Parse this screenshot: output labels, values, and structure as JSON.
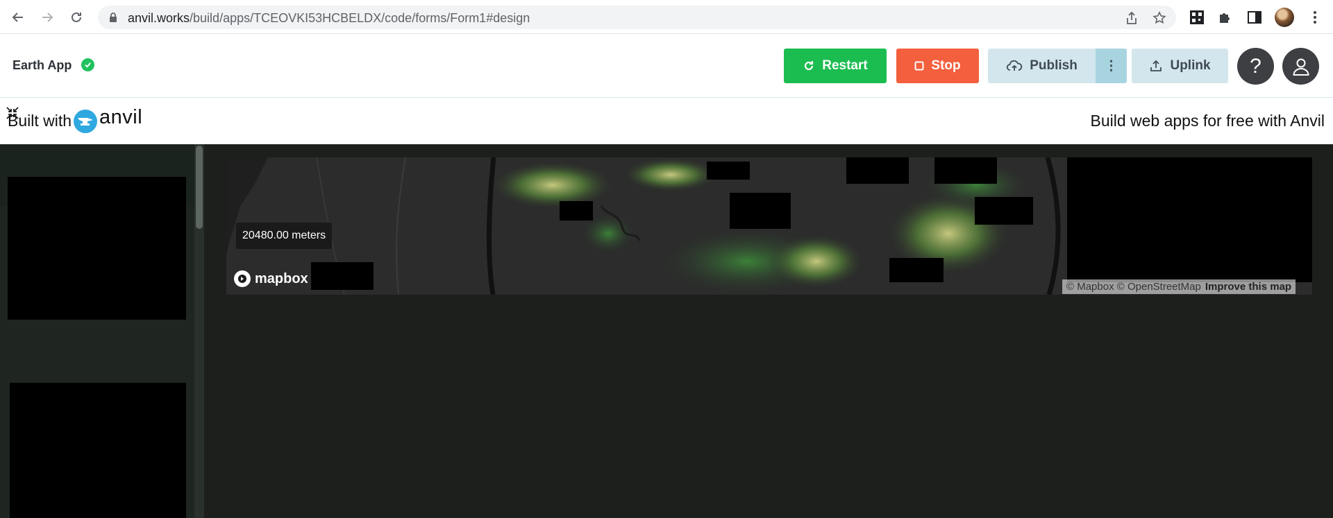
{
  "browser": {
    "url_host": "anvil.works",
    "url_path": "/build/apps/TCEOVKI53HCBELDX/code/forms/Form1#design"
  },
  "header": {
    "app_name": "Earth App",
    "restart_label": "Restart",
    "stop_label": "Stop",
    "publish_label": "Publish",
    "more_label": "⋮",
    "uplink_label": "Uplink",
    "help_label": "?"
  },
  "built_with": {
    "prefix": "Built with",
    "brand": "anvil",
    "cta": "Build web apps for free with Anvil"
  },
  "map": {
    "scale": "20480.00 meters",
    "logo": "mapbox",
    "attribution": "© Mapbox © OpenStreetMap",
    "improve": "Improve this map"
  },
  "colors": {
    "restart": "#1cbd50",
    "stop": "#f45f3d",
    "publish": "#d3e6ed",
    "status_ok": "#21c25e",
    "anvil_brand": "#2fa8e0"
  },
  "icons": [
    "back-icon",
    "forward-icon",
    "reload-icon",
    "lock-icon",
    "share-icon",
    "star-icon",
    "qr-icon",
    "puzzle-icon",
    "sidepanel-icon",
    "menu-icon",
    "check-icon",
    "restart-icon",
    "stop-icon",
    "cloud-upload-icon",
    "upload-icon",
    "user-icon",
    "collapse-icon",
    "anvil-logo-icon",
    "mapbox-icon"
  ]
}
